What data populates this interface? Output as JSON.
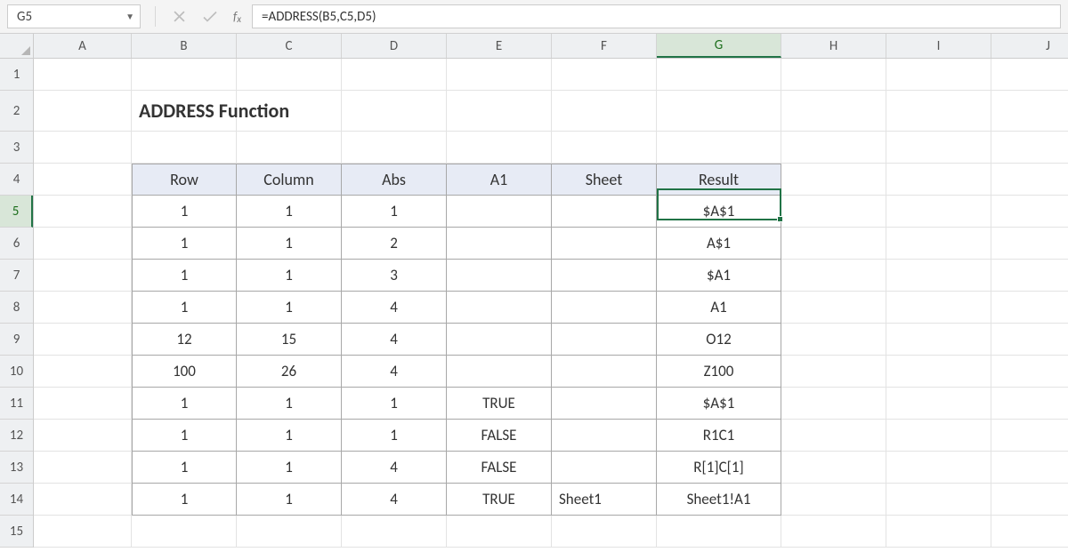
{
  "formula_bar": {
    "name_box": "G5",
    "formula": "=ADDRESS(B5,C5,D5)"
  },
  "columns": [
    "A",
    "B",
    "C",
    "D",
    "E",
    "F",
    "G",
    "H",
    "I",
    "J"
  ],
  "rows": [
    "1",
    "2",
    "3",
    "4",
    "5",
    "6",
    "7",
    "8",
    "9",
    "10",
    "11",
    "12",
    "13",
    "14",
    "15"
  ],
  "active_col": "G",
  "active_row": "5",
  "title": "ADDRESS Function",
  "headers": [
    "Row",
    "Column",
    "Abs",
    "A1",
    "Sheet",
    "Result"
  ],
  "data": [
    {
      "row": "1",
      "col": "1",
      "abs": "1",
      "a1": "",
      "sheet": "",
      "result": "$A$1"
    },
    {
      "row": "1",
      "col": "1",
      "abs": "2",
      "a1": "",
      "sheet": "",
      "result": "A$1"
    },
    {
      "row": "1",
      "col": "1",
      "abs": "3",
      "a1": "",
      "sheet": "",
      "result": "$A1"
    },
    {
      "row": "1",
      "col": "1",
      "abs": "4",
      "a1": "",
      "sheet": "",
      "result": "A1"
    },
    {
      "row": "12",
      "col": "15",
      "abs": "4",
      "a1": "",
      "sheet": "",
      "result": "O12"
    },
    {
      "row": "100",
      "col": "26",
      "abs": "4",
      "a1": "",
      "sheet": "",
      "result": "Z100"
    },
    {
      "row": "1",
      "col": "1",
      "abs": "1",
      "a1": "TRUE",
      "sheet": "",
      "result": "$A$1"
    },
    {
      "row": "1",
      "col": "1",
      "abs": "1",
      "a1": "FALSE",
      "sheet": "",
      "result": "R1C1"
    },
    {
      "row": "1",
      "col": "1",
      "abs": "4",
      "a1": "FALSE",
      "sheet": "",
      "result": "R[1]C[1]"
    },
    {
      "row": "1",
      "col": "1",
      "abs": "4",
      "a1": "TRUE",
      "sheet": "Sheet1",
      "result": "Sheet1!A1"
    }
  ]
}
